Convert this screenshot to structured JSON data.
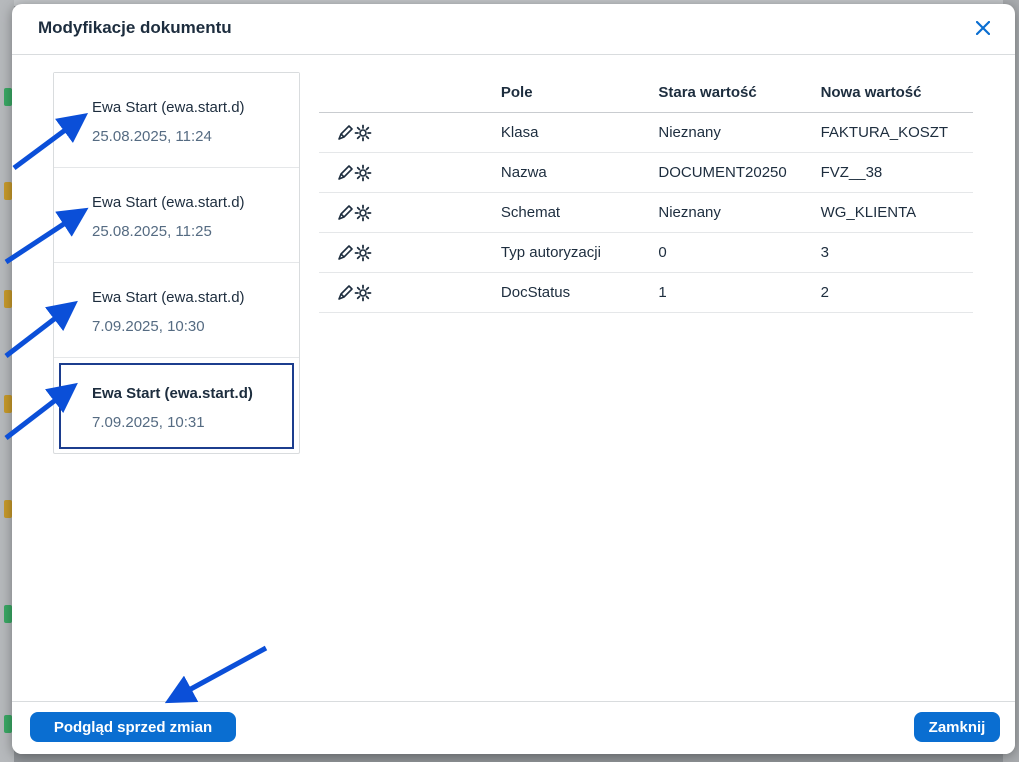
{
  "dialog": {
    "title": "Modyfikacje dokumentu",
    "close_icon": "close-icon"
  },
  "history": [
    {
      "user": "Ewa Start (ewa.start.d)",
      "date": "25.08.2025, 11:24",
      "selected": false
    },
    {
      "user": "Ewa Start (ewa.start.d)",
      "date": "25.08.2025, 11:25",
      "selected": false
    },
    {
      "user": "Ewa Start (ewa.start.d)",
      "date": "7.09.2025, 10:30",
      "selected": false
    },
    {
      "user": "Ewa Start (ewa.start.d)",
      "date": "7.09.2025, 10:31",
      "selected": true
    }
  ],
  "table": {
    "headers": {
      "icons": "",
      "field": "Pole",
      "old": "Stara wartość",
      "new": "Nowa wartość"
    },
    "rows": [
      {
        "icon": "edit-settings-icon",
        "field": "Klasa",
        "old": "Nieznany",
        "new": "FAKTURA_KOSZT"
      },
      {
        "icon": "edit-settings-icon",
        "field": "Nazwa",
        "old": "DOCUMENT20250",
        "new": "FVZ__38"
      },
      {
        "icon": "edit-settings-icon",
        "field": "Schemat",
        "old": "Nieznany",
        "new": "WG_KLIENTA"
      },
      {
        "icon": "edit-settings-icon",
        "field": "Typ autoryzacji",
        "old": "0",
        "new": "3"
      },
      {
        "icon": "edit-settings-icon",
        "field": "DocStatus",
        "old": "1",
        "new": "2"
      }
    ]
  },
  "footer": {
    "preview_label": "Podgląd sprzed zmian",
    "close_label": "Zamknij"
  },
  "colors": {
    "accent": "#0a6ed1",
    "selected_border": "#1c3d8e",
    "annotation_arrow": "#0b4fd8"
  }
}
